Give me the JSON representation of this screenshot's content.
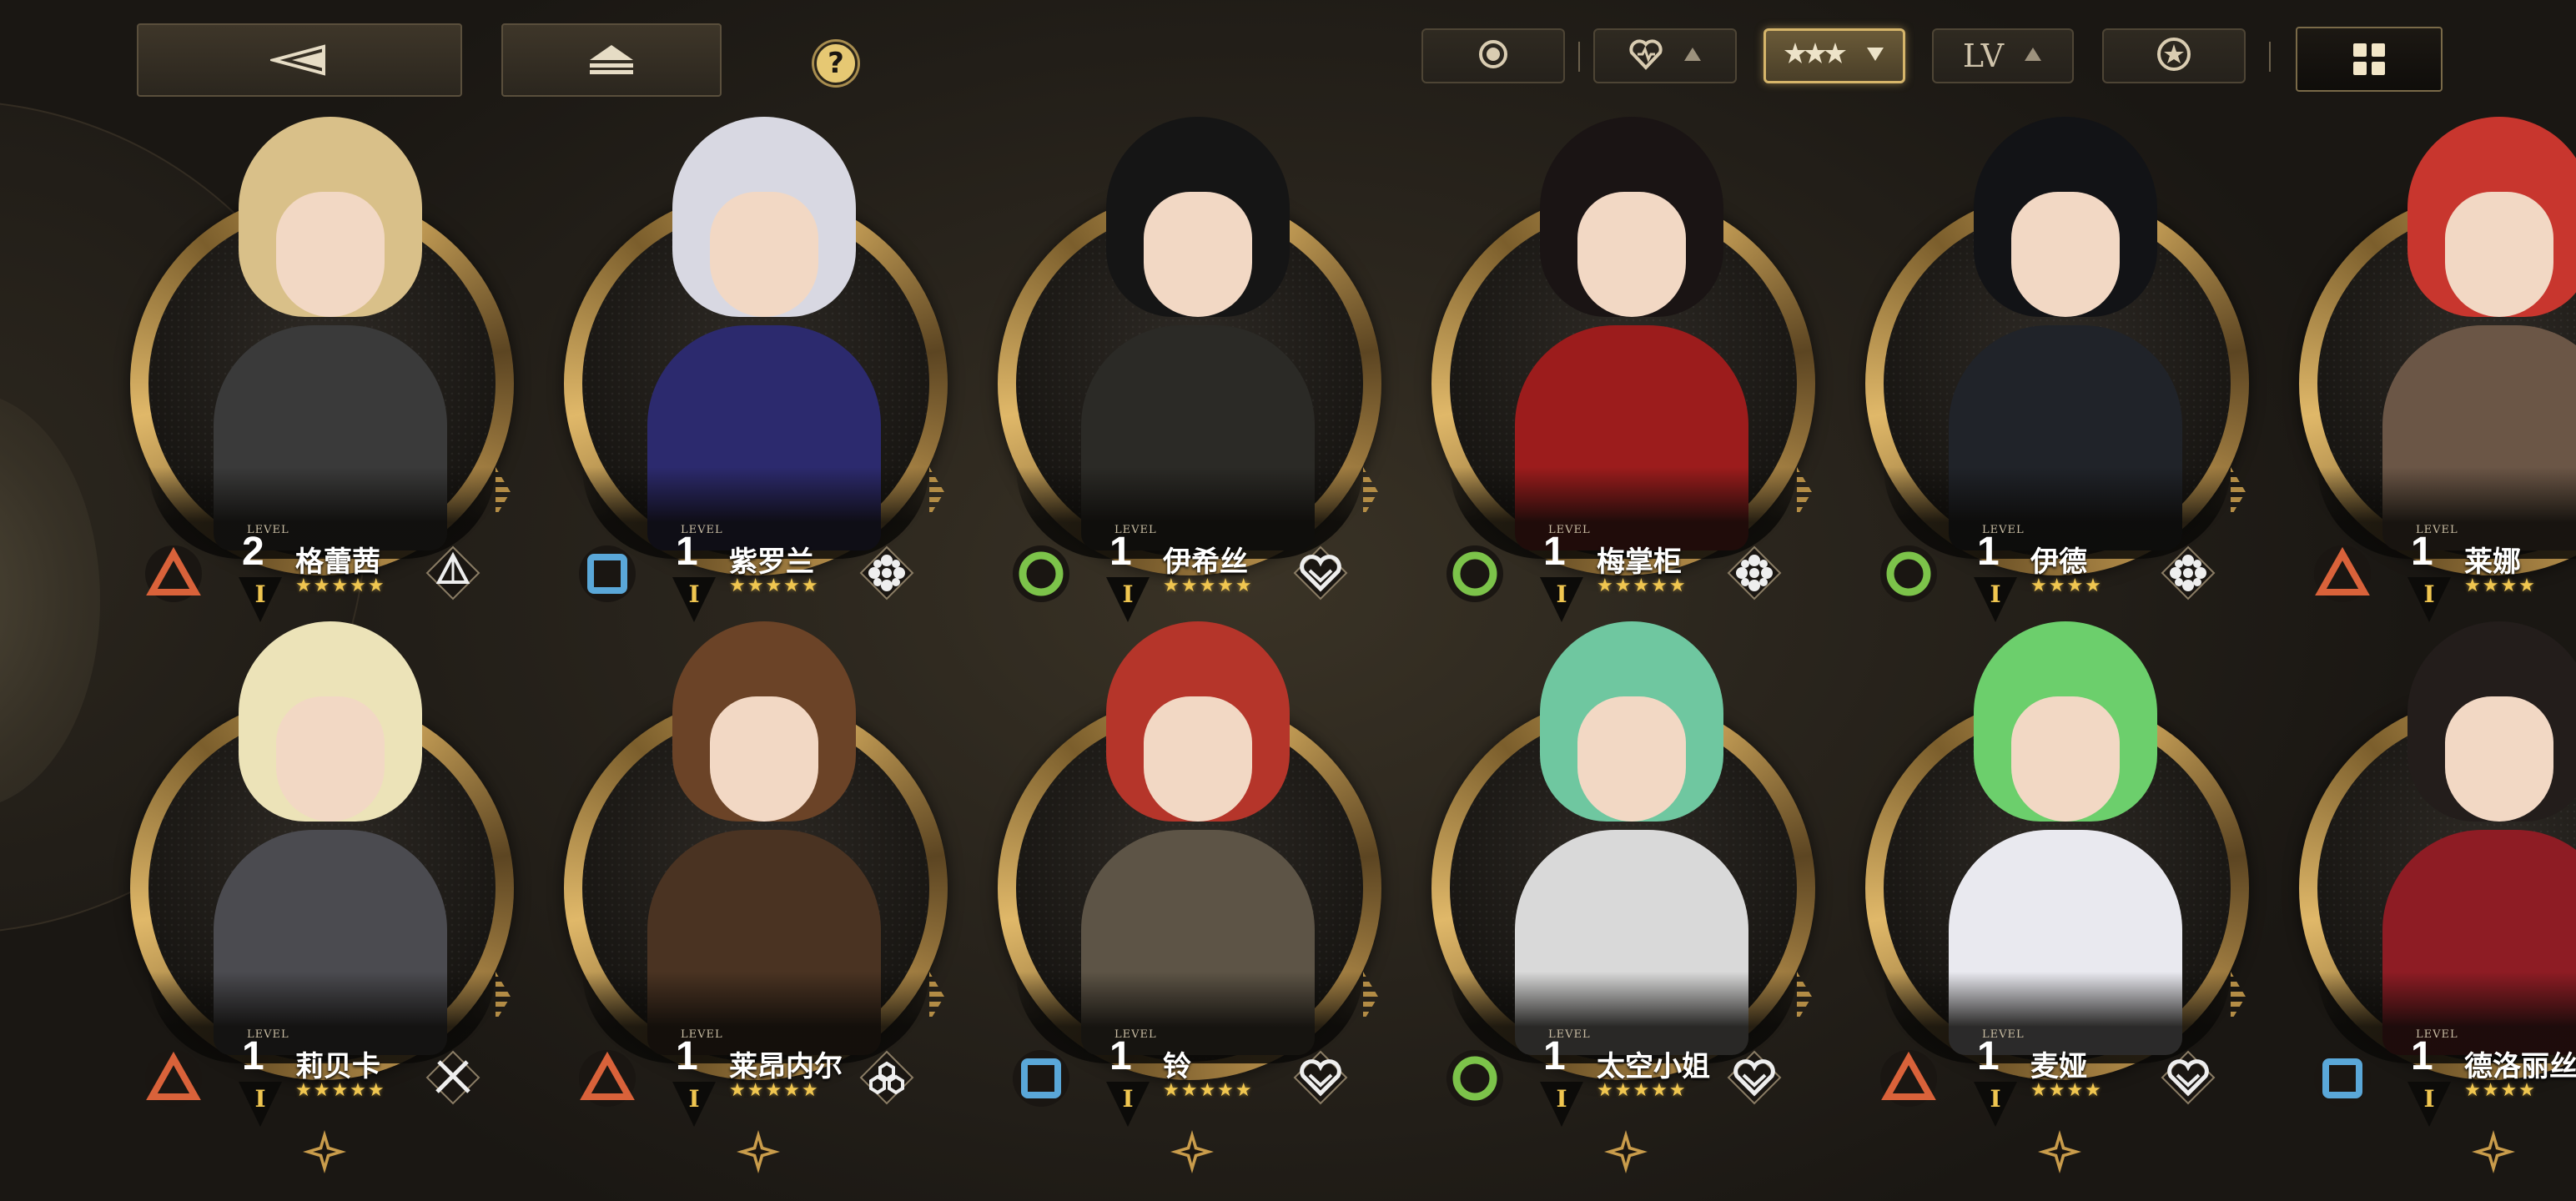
{
  "toolbar": {
    "back_icon": "back-triangle-icon",
    "sort_icon": "eject-sort-icon",
    "help_label": "?",
    "filters": [
      {
        "id": "filter-attribute",
        "icon": "ring-dot-icon",
        "active": false
      },
      {
        "id": "filter-affinity",
        "icon": "heart-icon",
        "has_arrow": true,
        "active": false
      },
      {
        "id": "filter-rarity",
        "icon": "stars-icon",
        "has_arrow": true,
        "active": true
      },
      {
        "id": "filter-level",
        "label": "LV",
        "has_arrow": true,
        "active": false
      },
      {
        "id": "filter-favorite",
        "icon": "star-badge-icon",
        "active": false
      }
    ],
    "view_icon": "grid-view-icon"
  },
  "level_label": "LEVEL",
  "colors": {
    "gold": "#e0b869",
    "star": "#f0c650",
    "type_red": "#d9623a",
    "type_blue": "#5aa7d8",
    "type_green": "#7cc34a"
  },
  "characters": [
    {
      "name": "格蕾茜",
      "level": "2",
      "rank": "I",
      "stars": "★★★★★",
      "type": "triangle",
      "class_icon": "spire-icon",
      "hair": "#d9c089",
      "outfit": "#3a3a3a"
    },
    {
      "name": "紫罗兰",
      "level": "1",
      "rank": "I",
      "stars": "★★★★★",
      "type": "square",
      "class_icon": "crystal-flower-icon",
      "hair": "#d8d8e2",
      "outfit": "#2c2a6e"
    },
    {
      "name": "伊希丝",
      "level": "1",
      "rank": "I",
      "stars": "★★★★★",
      "type": "circle",
      "class_icon": "heart-knot-icon",
      "hair": "#151515",
      "outfit": "#2b2a26"
    },
    {
      "name": "梅掌柜",
      "level": "1",
      "rank": "I",
      "stars": "★★★★★",
      "type": "circle",
      "class_icon": "crystal-flower-icon",
      "hair": "#1a1414",
      "outfit": "#9c1c1c"
    },
    {
      "name": "伊德",
      "level": "1",
      "rank": "I",
      "stars": "★★★★",
      "type": "circle",
      "class_icon": "crystal-flower-icon",
      "hair": "#121316",
      "outfit": "#202329"
    },
    {
      "name": "莱娜",
      "level": "1",
      "rank": "I",
      "stars": "★★★★",
      "type": "triangle",
      "class_icon": "",
      "hair": "#c8362e",
      "outfit": "#6b5646"
    },
    {
      "name": "莉贝卡",
      "level": "1",
      "rank": "I",
      "stars": "★★★★★",
      "type": "triangle",
      "class_icon": "crossed-swords-icon",
      "hair": "#ece3b8",
      "outfit": "#4b4b50"
    },
    {
      "name": "莱昂内尔",
      "level": "1",
      "rank": "I",
      "stars": "★★★★★",
      "type": "triangle",
      "class_icon": "hex-cluster-icon",
      "hair": "#6b4327",
      "outfit": "#4a3322"
    },
    {
      "name": "铃",
      "level": "1",
      "rank": "I",
      "stars": "★★★★★",
      "type": "square",
      "class_icon": "heart-knot-icon",
      "hair": "#b5352a",
      "outfit": "#5d5446"
    },
    {
      "name": "太空小姐",
      "level": "1",
      "rank": "I",
      "stars": "★★★★★",
      "type": "circle",
      "class_icon": "heart-knot-icon",
      "hair": "#6fc7a0",
      "outfit": "#d9d9d9"
    },
    {
      "name": "麦娅",
      "level": "1",
      "rank": "I",
      "stars": "★★★★",
      "type": "triangle",
      "class_icon": "heart-knot-icon",
      "hair": "#6ccf6c",
      "outfit": "#e9e9ef"
    },
    {
      "name": "德洛丽丝",
      "level": "1",
      "rank": "I",
      "stars": "★★★★",
      "type": "square",
      "class_icon": "",
      "hair": "#231d1b",
      "outfit": "#8e1c24"
    }
  ]
}
